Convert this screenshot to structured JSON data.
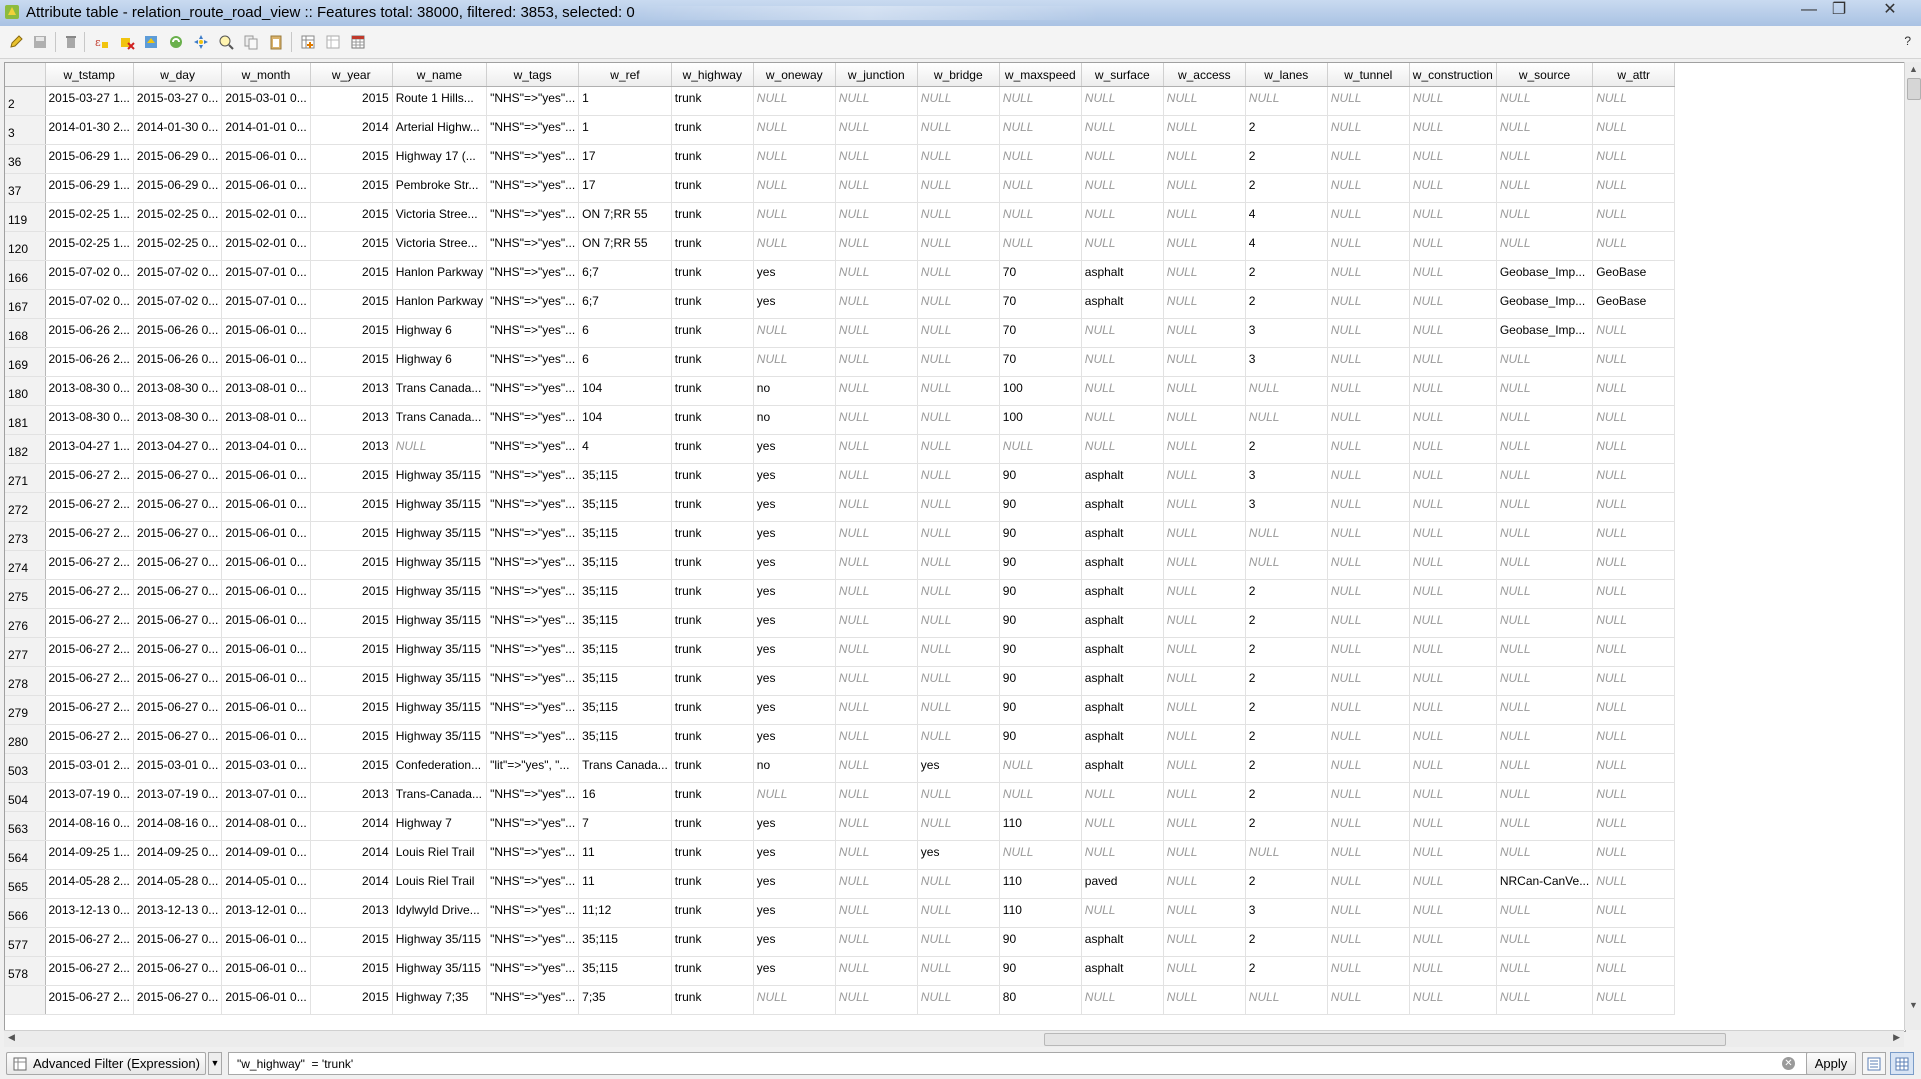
{
  "window": {
    "title": "Attribute table - relation_route_road_view :: Features total: 38000, filtered: 3853, selected: 0",
    "min": "—",
    "max": "❐",
    "close": "✕"
  },
  "toolbar": {
    "help": "?",
    "icons": [
      "pencil-icon",
      "save-icon",
      "delete-icon",
      "select-by-expression-icon",
      "deselect-icon",
      "move-selection-top-icon",
      "invert-selection-icon",
      "pan-to-selection-icon",
      "zoom-to-selection-icon",
      "copy-icon",
      "paste-icon",
      "new-field-icon",
      "delete-field-icon",
      "field-calculator-icon"
    ]
  },
  "table": {
    "columns": [
      "w_tstamp",
      "w_day",
      "w_month",
      "w_year",
      "w_name",
      "w_tags",
      "w_ref",
      "w_highway",
      "w_oneway",
      "w_junction",
      "w_bridge",
      "w_maxspeed",
      "w_surface",
      "w_access",
      "w_lanes",
      "w_tunnel",
      "w_construction",
      "w_source",
      "w_attr"
    ],
    "rows": [
      [
        "2",
        "2015-03-27 1...",
        "2015-03-27 0...",
        "2015-03-01 0...",
        "2015",
        "Route 1  Hills...",
        "\"NHS\"=>\"yes\"...",
        "1",
        "trunk",
        "NULL",
        "NULL",
        "NULL",
        "NULL",
        "NULL",
        "NULL",
        "NULL",
        "NULL",
        "NULL",
        "NULL",
        "NULL"
      ],
      [
        "3",
        "2014-01-30 2...",
        "2014-01-30 0...",
        "2014-01-01 0...",
        "2014",
        "Arterial Highw...",
        "\"NHS\"=>\"yes\"...",
        "1",
        "trunk",
        "NULL",
        "NULL",
        "NULL",
        "NULL",
        "NULL",
        "NULL",
        "2",
        "NULL",
        "NULL",
        "NULL",
        "NULL"
      ],
      [
        "36",
        "2015-06-29 1...",
        "2015-06-29 0...",
        "2015-06-01 0...",
        "2015",
        "Highway 17 (...",
        "\"NHS\"=>\"yes\"...",
        "17",
        "trunk",
        "NULL",
        "NULL",
        "NULL",
        "NULL",
        "NULL",
        "NULL",
        "2",
        "NULL",
        "NULL",
        "NULL",
        "NULL"
      ],
      [
        "37",
        "2015-06-29 1...",
        "2015-06-29 0...",
        "2015-06-01 0...",
        "2015",
        "Pembroke Str...",
        "\"NHS\"=>\"yes\"...",
        "17",
        "trunk",
        "NULL",
        "NULL",
        "NULL",
        "NULL",
        "NULL",
        "NULL",
        "2",
        "NULL",
        "NULL",
        "NULL",
        "NULL"
      ],
      [
        "119",
        "2015-02-25 1...",
        "2015-02-25 0...",
        "2015-02-01 0...",
        "2015",
        "Victoria Stree...",
        "\"NHS\"=>\"yes\"...",
        "ON 7;RR 55",
        "trunk",
        "NULL",
        "NULL",
        "NULL",
        "NULL",
        "NULL",
        "NULL",
        "4",
        "NULL",
        "NULL",
        "NULL",
        "NULL"
      ],
      [
        "120",
        "2015-02-25 1...",
        "2015-02-25 0...",
        "2015-02-01 0...",
        "2015",
        "Victoria Stree...",
        "\"NHS\"=>\"yes\"...",
        "ON 7;RR 55",
        "trunk",
        "NULL",
        "NULL",
        "NULL",
        "NULL",
        "NULL",
        "NULL",
        "4",
        "NULL",
        "NULL",
        "NULL",
        "NULL"
      ],
      [
        "166",
        "2015-07-02 0...",
        "2015-07-02 0...",
        "2015-07-01 0...",
        "2015",
        "Hanlon Parkway",
        "\"NHS\"=>\"yes\"...",
        "6;7",
        "trunk",
        "yes",
        "NULL",
        "NULL",
        "70",
        "asphalt",
        "NULL",
        "2",
        "NULL",
        "NULL",
        "Geobase_Imp...",
        "GeoBase"
      ],
      [
        "167",
        "2015-07-02 0...",
        "2015-07-02 0...",
        "2015-07-01 0...",
        "2015",
        "Hanlon Parkway",
        "\"NHS\"=>\"yes\"...",
        "6;7",
        "trunk",
        "yes",
        "NULL",
        "NULL",
        "70",
        "asphalt",
        "NULL",
        "2",
        "NULL",
        "NULL",
        "Geobase_Imp...",
        "GeoBase"
      ],
      [
        "168",
        "2015-06-26 2...",
        "2015-06-26 0...",
        "2015-06-01 0...",
        "2015",
        "Highway 6",
        "\"NHS\"=>\"yes\"...",
        "6",
        "trunk",
        "NULL",
        "NULL",
        "NULL",
        "70",
        "NULL",
        "NULL",
        "3",
        "NULL",
        "NULL",
        "Geobase_Imp...",
        "NULL"
      ],
      [
        "169",
        "2015-06-26 2...",
        "2015-06-26 0...",
        "2015-06-01 0...",
        "2015",
        "Highway 6",
        "\"NHS\"=>\"yes\"...",
        "6",
        "trunk",
        "NULL",
        "NULL",
        "NULL",
        "70",
        "NULL",
        "NULL",
        "3",
        "NULL",
        "NULL",
        "NULL",
        "NULL"
      ],
      [
        "180",
        "2013-08-30 0...",
        "2013-08-30 0...",
        "2013-08-01 0...",
        "2013",
        "Trans Canada...",
        "\"NHS\"=>\"yes\"...",
        "104",
        "trunk",
        "no",
        "NULL",
        "NULL",
        "100",
        "NULL",
        "NULL",
        "NULL",
        "NULL",
        "NULL",
        "NULL",
        "NULL"
      ],
      [
        "181",
        "2013-08-30 0...",
        "2013-08-30 0...",
        "2013-08-01 0...",
        "2013",
        "Trans Canada...",
        "\"NHS\"=>\"yes\"...",
        "104",
        "trunk",
        "no",
        "NULL",
        "NULL",
        "100",
        "NULL",
        "NULL",
        "NULL",
        "NULL",
        "NULL",
        "NULL",
        "NULL"
      ],
      [
        "182",
        "2013-04-27 1...",
        "2013-04-27 0...",
        "2013-04-01 0...",
        "2013",
        "NULL",
        "\"NHS\"=>\"yes\"...",
        "4",
        "trunk",
        "yes",
        "NULL",
        "NULL",
        "NULL",
        "NULL",
        "NULL",
        "2",
        "NULL",
        "NULL",
        "NULL",
        "NULL"
      ],
      [
        "271",
        "2015-06-27 2...",
        "2015-06-27 0...",
        "2015-06-01 0...",
        "2015",
        "Highway 35/115",
        "\"NHS\"=>\"yes\"...",
        "35;115",
        "trunk",
        "yes",
        "NULL",
        "NULL",
        "90",
        "asphalt",
        "NULL",
        "3",
        "NULL",
        "NULL",
        "NULL",
        "NULL"
      ],
      [
        "272",
        "2015-06-27 2...",
        "2015-06-27 0...",
        "2015-06-01 0...",
        "2015",
        "Highway 35/115",
        "\"NHS\"=>\"yes\"...",
        "35;115",
        "trunk",
        "yes",
        "NULL",
        "NULL",
        "90",
        "asphalt",
        "NULL",
        "3",
        "NULL",
        "NULL",
        "NULL",
        "NULL"
      ],
      [
        "273",
        "2015-06-27 2...",
        "2015-06-27 0...",
        "2015-06-01 0...",
        "2015",
        "Highway 35/115",
        "\"NHS\"=>\"yes\"...",
        "35;115",
        "trunk",
        "yes",
        "NULL",
        "NULL",
        "90",
        "asphalt",
        "NULL",
        "NULL",
        "NULL",
        "NULL",
        "NULL",
        "NULL"
      ],
      [
        "274",
        "2015-06-27 2...",
        "2015-06-27 0...",
        "2015-06-01 0...",
        "2015",
        "Highway 35/115",
        "\"NHS\"=>\"yes\"...",
        "35;115",
        "trunk",
        "yes",
        "NULL",
        "NULL",
        "90",
        "asphalt",
        "NULL",
        "NULL",
        "NULL",
        "NULL",
        "NULL",
        "NULL"
      ],
      [
        "275",
        "2015-06-27 2...",
        "2015-06-27 0...",
        "2015-06-01 0...",
        "2015",
        "Highway 35/115",
        "\"NHS\"=>\"yes\"...",
        "35;115",
        "trunk",
        "yes",
        "NULL",
        "NULL",
        "90",
        "asphalt",
        "NULL",
        "2",
        "NULL",
        "NULL",
        "NULL",
        "NULL"
      ],
      [
        "276",
        "2015-06-27 2...",
        "2015-06-27 0...",
        "2015-06-01 0...",
        "2015",
        "Highway 35/115",
        "\"NHS\"=>\"yes\"...",
        "35;115",
        "trunk",
        "yes",
        "NULL",
        "NULL",
        "90",
        "asphalt",
        "NULL",
        "2",
        "NULL",
        "NULL",
        "NULL",
        "NULL"
      ],
      [
        "277",
        "2015-06-27 2...",
        "2015-06-27 0...",
        "2015-06-01 0...",
        "2015",
        "Highway 35/115",
        "\"NHS\"=>\"yes\"...",
        "35;115",
        "trunk",
        "yes",
        "NULL",
        "NULL",
        "90",
        "asphalt",
        "NULL",
        "2",
        "NULL",
        "NULL",
        "NULL",
        "NULL"
      ],
      [
        "278",
        "2015-06-27 2...",
        "2015-06-27 0...",
        "2015-06-01 0...",
        "2015",
        "Highway 35/115",
        "\"NHS\"=>\"yes\"...",
        "35;115",
        "trunk",
        "yes",
        "NULL",
        "NULL",
        "90",
        "asphalt",
        "NULL",
        "2",
        "NULL",
        "NULL",
        "NULL",
        "NULL"
      ],
      [
        "279",
        "2015-06-27 2...",
        "2015-06-27 0...",
        "2015-06-01 0...",
        "2015",
        "Highway 35/115",
        "\"NHS\"=>\"yes\"...",
        "35;115",
        "trunk",
        "yes",
        "NULL",
        "NULL",
        "90",
        "asphalt",
        "NULL",
        "2",
        "NULL",
        "NULL",
        "NULL",
        "NULL"
      ],
      [
        "280",
        "2015-06-27 2...",
        "2015-06-27 0...",
        "2015-06-01 0...",
        "2015",
        "Highway 35/115",
        "\"NHS\"=>\"yes\"...",
        "35;115",
        "trunk",
        "yes",
        "NULL",
        "NULL",
        "90",
        "asphalt",
        "NULL",
        "2",
        "NULL",
        "NULL",
        "NULL",
        "NULL"
      ],
      [
        "503",
        "2015-03-01 2...",
        "2015-03-01 0...",
        "2015-03-01 0...",
        "2015",
        "Confederation...",
        "\"lit\"=>\"yes\", \"...",
        "Trans Canada...",
        "trunk",
        "no",
        "NULL",
        "yes",
        "NULL",
        "asphalt",
        "NULL",
        "2",
        "NULL",
        "NULL",
        "NULL",
        "NULL"
      ],
      [
        "504",
        "2013-07-19 0...",
        "2013-07-19 0...",
        "2013-07-01 0...",
        "2013",
        "Trans-Canada...",
        "\"NHS\"=>\"yes\"...",
        "16",
        "trunk",
        "NULL",
        "NULL",
        "NULL",
        "NULL",
        "NULL",
        "NULL",
        "2",
        "NULL",
        "NULL",
        "NULL",
        "NULL"
      ],
      [
        "563",
        "2014-08-16 0...",
        "2014-08-16 0...",
        "2014-08-01 0...",
        "2014",
        "Highway 7",
        "\"NHS\"=>\"yes\"...",
        "7",
        "trunk",
        "yes",
        "NULL",
        "NULL",
        "110",
        "NULL",
        "NULL",
        "2",
        "NULL",
        "NULL",
        "NULL",
        "NULL"
      ],
      [
        "564",
        "2014-09-25 1...",
        "2014-09-25 0...",
        "2014-09-01 0...",
        "2014",
        "Louis Riel Trail",
        "\"NHS\"=>\"yes\"...",
        "11",
        "trunk",
        "yes",
        "NULL",
        "yes",
        "NULL",
        "NULL",
        "NULL",
        "NULL",
        "NULL",
        "NULL",
        "NULL",
        "NULL"
      ],
      [
        "565",
        "2014-05-28 2...",
        "2014-05-28 0...",
        "2014-05-01 0...",
        "2014",
        "Louis Riel Trail",
        "\"NHS\"=>\"yes\"...",
        "11",
        "trunk",
        "yes",
        "NULL",
        "NULL",
        "110",
        "paved",
        "NULL",
        "2",
        "NULL",
        "NULL",
        "NRCan-CanVe...",
        "NULL"
      ],
      [
        "566",
        "2013-12-13 0...",
        "2013-12-13 0...",
        "2013-12-01 0...",
        "2013",
        "Idylwyld Drive...",
        "\"NHS\"=>\"yes\"...",
        "11;12",
        "trunk",
        "yes",
        "NULL",
        "NULL",
        "110",
        "NULL",
        "NULL",
        "3",
        "NULL",
        "NULL",
        "NULL",
        "NULL"
      ],
      [
        "577",
        "2015-06-27 2...",
        "2015-06-27 0...",
        "2015-06-01 0...",
        "2015",
        "Highway 35/115",
        "\"NHS\"=>\"yes\"...",
        "35;115",
        "trunk",
        "yes",
        "NULL",
        "NULL",
        "90",
        "asphalt",
        "NULL",
        "2",
        "NULL",
        "NULL",
        "NULL",
        "NULL"
      ],
      [
        "578",
        "2015-06-27 2...",
        "2015-06-27 0...",
        "2015-06-01 0...",
        "2015",
        "Highway 35/115",
        "\"NHS\"=>\"yes\"...",
        "35;115",
        "trunk",
        "yes",
        "NULL",
        "NULL",
        "90",
        "asphalt",
        "NULL",
        "2",
        "NULL",
        "NULL",
        "NULL",
        "NULL"
      ],
      [
        "",
        "2015-06-27 2...",
        "2015-06-27 0...",
        "2015-06-01 0...",
        "2015",
        "Highway 7;35",
        "\"NHS\"=>\"yes\"...",
        "7;35",
        "trunk",
        "NULL",
        "NULL",
        "NULL",
        "80",
        "NULL",
        "NULL",
        "NULL",
        "NULL",
        "NULL",
        "NULL",
        "NULL"
      ]
    ]
  },
  "filter": {
    "mode_label": "Advanced Filter (Expression)",
    "expression": "\"w_highway\"  = 'trunk'",
    "apply_label": "Apply",
    "clear": "✕"
  },
  "colors": {
    "title_bar": "#b4cbe8",
    "null_text": "#9a9a9a",
    "header_bg": "#f2f2f2"
  }
}
